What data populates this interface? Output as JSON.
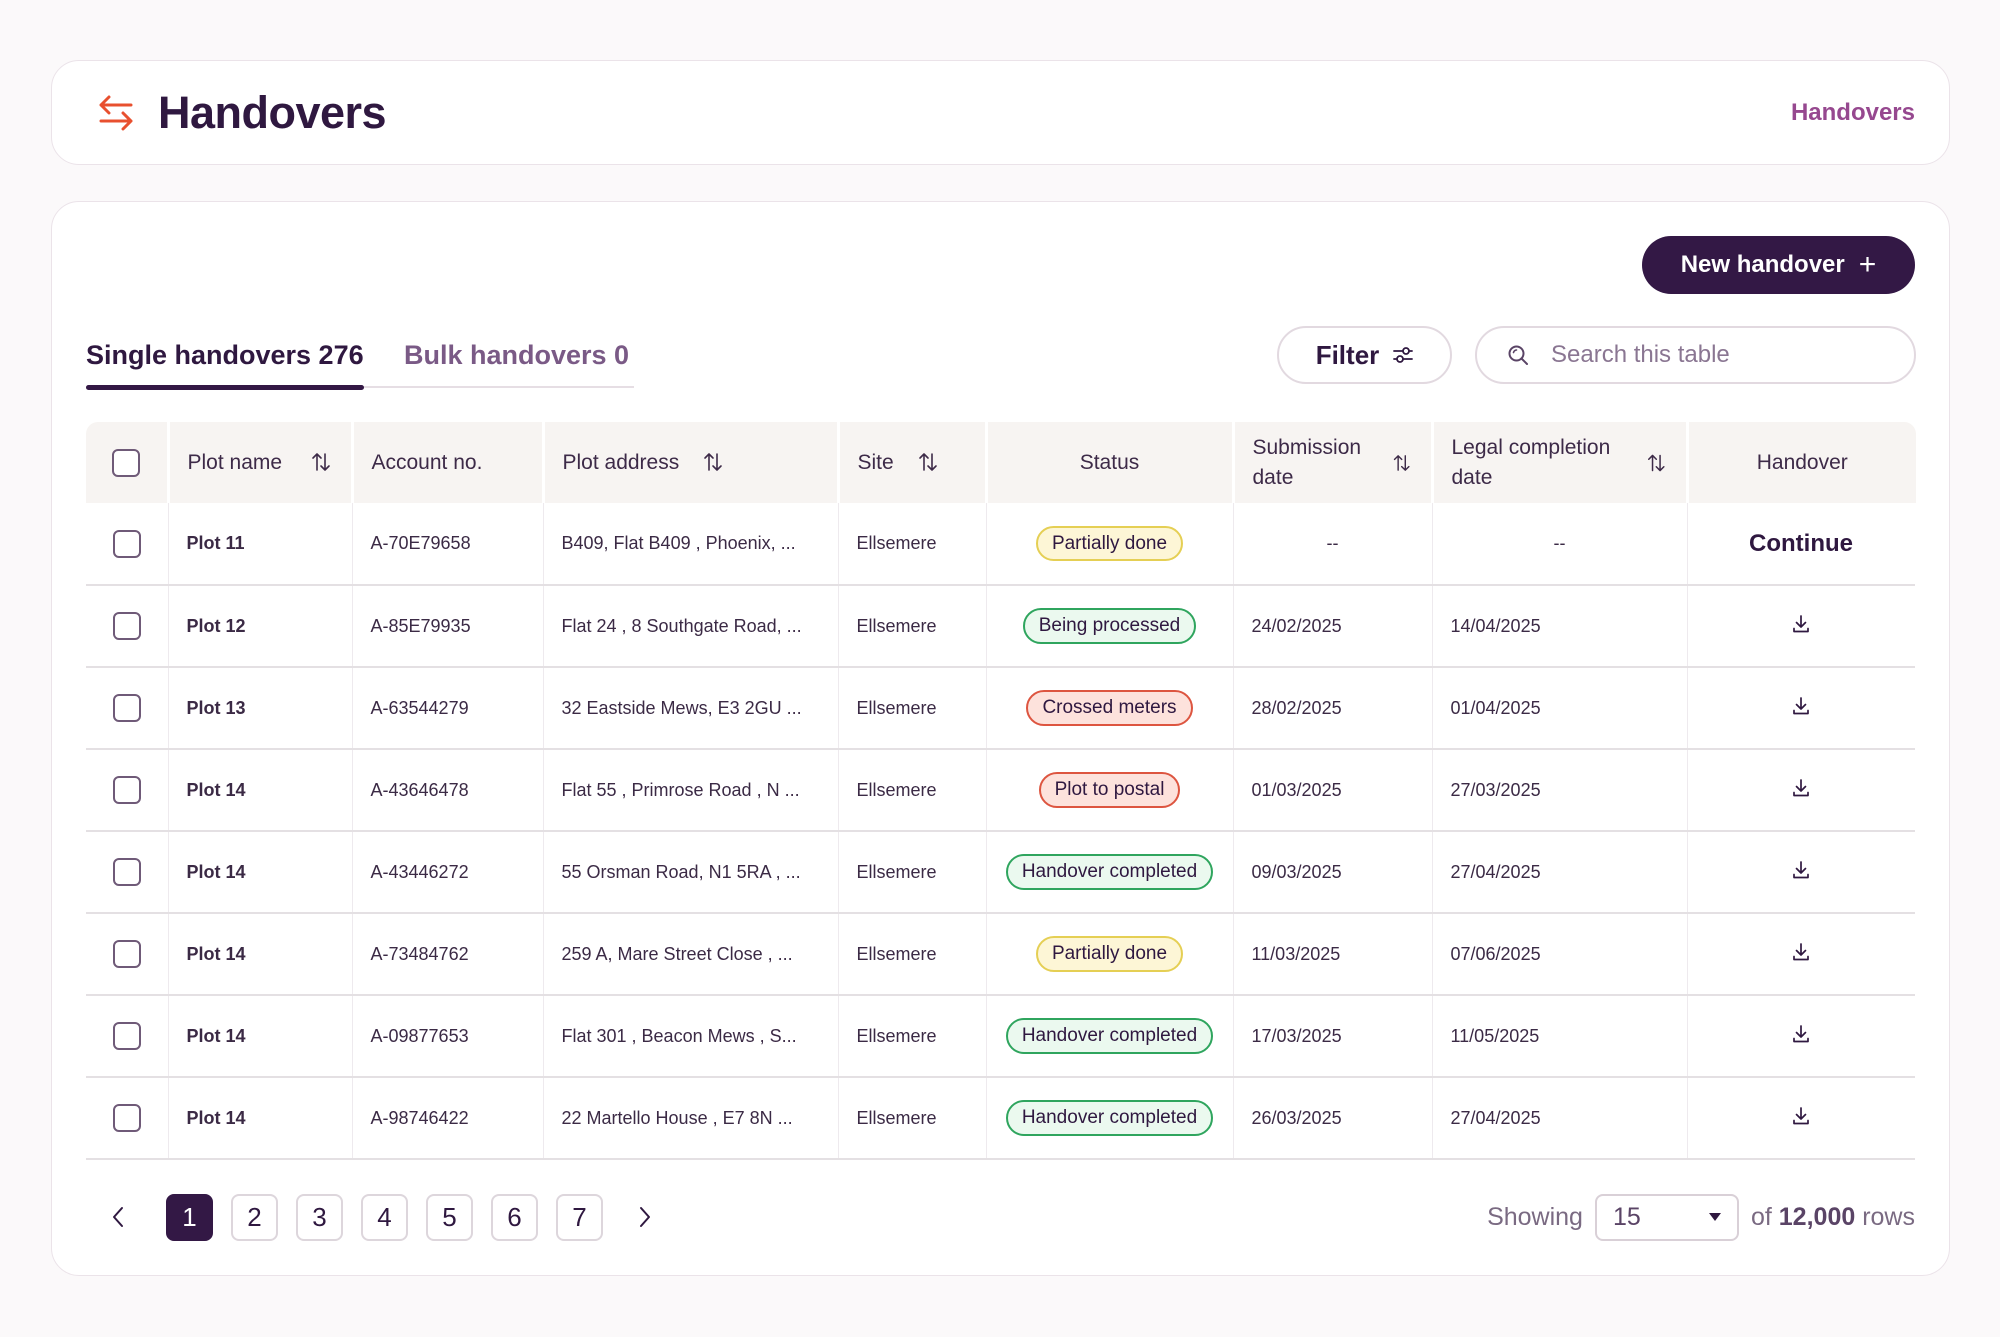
{
  "header": {
    "title": "Handovers",
    "breadcrumb": "Handovers",
    "icon": "swap-arrows-icon",
    "accent_color": "#e8502f"
  },
  "toolbar": {
    "new_button_label": "New handover",
    "filter_label": "Filter",
    "search_placeholder": "Search this table"
  },
  "tabs": [
    {
      "label": "Single handovers 276",
      "active": true
    },
    {
      "label": "Bulk handovers 0",
      "active": false
    }
  ],
  "table": {
    "columns": {
      "plot_name": "Plot name",
      "account_no": "Account no.",
      "plot_address": "Plot address",
      "site": "Site",
      "status": "Status",
      "submission_date": "Submission date",
      "legal_completion_date": "Legal completion date",
      "handover": "Handover"
    },
    "rows": [
      {
        "plot": "Plot 11",
        "account": "A-70E79658",
        "address": "B409,  Flat B409 , Phoenix, ...",
        "site": "Ellsemere",
        "status": "Partially done",
        "status_color": "yellow",
        "submission": "--",
        "completion": "--",
        "handover": "Continue"
      },
      {
        "plot": "Plot 12",
        "account": "A-85E79935",
        "address": "Flat 24 , 8 Southgate Road, ...",
        "site": "Ellsemere",
        "status": "Being processed",
        "status_color": "green",
        "submission": "24/02/2025",
        "completion": "14/04/2025",
        "handover": "download-icon"
      },
      {
        "plot": "Plot 13",
        "account": "A-63544279",
        "address": "32 Eastside Mews, E3 2GU ...",
        "site": "Ellsemere",
        "status": "Crossed meters",
        "status_color": "red",
        "submission": "28/02/2025",
        "completion": "01/04/2025",
        "handover": "download-icon"
      },
      {
        "plot": "Plot 14",
        "account": "A-43646478",
        "address": "Flat 55 , Primrose Road , N ...",
        "site": "Ellsemere",
        "status": "Plot to postal",
        "status_color": "red",
        "submission": "01/03/2025",
        "completion": "27/03/2025",
        "handover": "download-icon"
      },
      {
        "plot": "Plot 14",
        "account": "A-43446272",
        "address": "55 Orsman Road, N1 5RA , ...",
        "site": "Ellsemere",
        "status": "Handover completed",
        "status_color": "green",
        "submission": "09/03/2025",
        "completion": "27/04/2025",
        "handover": "download-icon"
      },
      {
        "plot": "Plot 14",
        "account": "A-73484762",
        "address": "259 A, Mare Street Close , ...",
        "site": "Ellsemere",
        "status": "Partially done",
        "status_color": "yellow",
        "submission": "11/03/2025",
        "completion": "07/06/2025",
        "handover": "download-icon"
      },
      {
        "plot": "Plot 14",
        "account": "A-09877653",
        "address": "Flat 301 , Beacon Mews , S...",
        "site": "Ellsemere",
        "status": "Handover completed",
        "status_color": "green",
        "submission": "17/03/2025",
        "completion": "11/05/2025",
        "handover": "download-icon"
      },
      {
        "plot": "Plot 14",
        "account": "A-98746422",
        "address": "22 Martello House , E7 8N ...",
        "site": "Ellsemere",
        "status": "Handover completed",
        "status_color": "green",
        "submission": "26/03/2025",
        "completion": "27/04/2025",
        "handover": "download-icon"
      }
    ]
  },
  "pagination": {
    "pages": [
      "1",
      "2",
      "3",
      "4",
      "5",
      "6",
      "7"
    ],
    "current": "1"
  },
  "footer": {
    "showing_label": "Showing",
    "rows_per_page": "15",
    "of_label": "of",
    "total": "12,000",
    "rows_label": "rows"
  },
  "colors": {
    "brand": "#331845",
    "accent": "#e8502f",
    "breadcrumb": "#96488f",
    "status_yellow": "#e5cf54",
    "status_green": "#2fa55e",
    "status_red": "#dd5540"
  }
}
